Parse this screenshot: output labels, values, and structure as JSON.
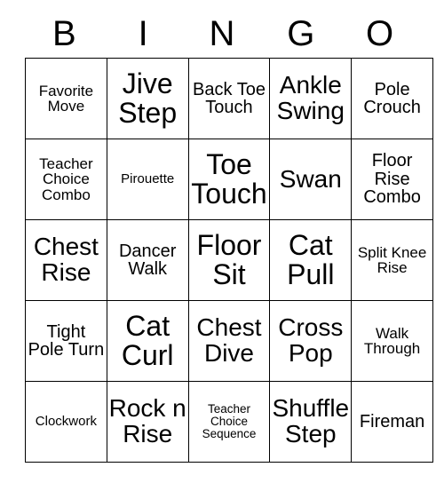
{
  "card": {
    "header_letters": [
      "B",
      "I",
      "N",
      "G",
      "O"
    ],
    "rows": [
      [
        {
          "text": "Favorite Move",
          "size": "s"
        },
        {
          "text": "Jive Step",
          "size": "xxl"
        },
        {
          "text": "Back Toe Touch",
          "size": "m"
        },
        {
          "text": "Ankle Swing",
          "size": "xl"
        },
        {
          "text": "Pole Crouch",
          "size": "m"
        }
      ],
      [
        {
          "text": "Teacher Choice Combo",
          "size": "s"
        },
        {
          "text": "Pirouette",
          "size": "xs"
        },
        {
          "text": "Toe Touch",
          "size": "xxl"
        },
        {
          "text": "Swan",
          "size": "xl"
        },
        {
          "text": "Floor Rise Combo",
          "size": "m"
        }
      ],
      [
        {
          "text": "Chest Rise",
          "size": "xl"
        },
        {
          "text": "Dancer Walk",
          "size": "m"
        },
        {
          "text": "Floor Sit",
          "size": "xxl"
        },
        {
          "text": "Cat Pull",
          "size": "xxl"
        },
        {
          "text": "Split Knee Rise",
          "size": "s"
        }
      ],
      [
        {
          "text": "Tight Pole Turn",
          "size": "m"
        },
        {
          "text": "Cat Curl",
          "size": "xxl"
        },
        {
          "text": "Chest Dive",
          "size": "xl"
        },
        {
          "text": "Cross Pop",
          "size": "xl"
        },
        {
          "text": "Walk Through",
          "size": "s"
        }
      ],
      [
        {
          "text": "Clockwork",
          "size": "xs"
        },
        {
          "text": "Rock n Rise",
          "size": "xl"
        },
        {
          "text": "Teacher Choice Sequence",
          "size": "xxs"
        },
        {
          "text": "Shuffle Step",
          "size": "xl"
        },
        {
          "text": "Fireman",
          "size": "m"
        }
      ]
    ]
  },
  "colors": {
    "background": "#ffffff",
    "text": "#000000",
    "border": "#000000"
  }
}
